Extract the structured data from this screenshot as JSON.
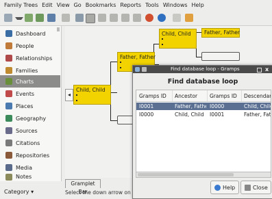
{
  "menubar": [
    "Family Trees",
    "Edit",
    "View",
    "Go",
    "Bookmarks",
    "Reports",
    "Tools",
    "Windows",
    "Help"
  ],
  "sidebar": {
    "items": [
      {
        "label": "Dashboard",
        "icon": "dashboard-icon",
        "color": "#3a6ea5"
      },
      {
        "label": "People",
        "icon": "people-icon",
        "color": "#c07a3a"
      },
      {
        "label": "Relationships",
        "icon": "relationships-icon",
        "color": "#b04a4a"
      },
      {
        "label": "Families",
        "icon": "families-icon",
        "color": "#c08a30"
      },
      {
        "label": "Charts",
        "icon": "charts-icon",
        "color": "#6a8f3a"
      },
      {
        "label": "Events",
        "icon": "events-icon",
        "color": "#c04a4a"
      },
      {
        "label": "Places",
        "icon": "places-icon",
        "color": "#4a7ab0"
      },
      {
        "label": "Geography",
        "icon": "geography-icon",
        "color": "#3a8a5a"
      },
      {
        "label": "Sources",
        "icon": "sources-icon",
        "color": "#6a6a8a"
      },
      {
        "label": "Citations",
        "icon": "citations-icon",
        "color": "#7a7a7a"
      },
      {
        "label": "Repositories",
        "icon": "repositories-icon",
        "color": "#8a5a3a"
      },
      {
        "label": "Media",
        "icon": "media-icon",
        "color": "#5a6a8a"
      },
      {
        "label": "Notes",
        "icon": "notes-icon",
        "color": "#8a8a5a"
      }
    ],
    "active_index": 4,
    "category_label": "Category ▾"
  },
  "chart": {
    "boxes": [
      {
        "name": "Child, Child"
      },
      {
        "name": "Father, Father"
      },
      {
        "name": "Child, Child"
      },
      {
        "name": "Father, Father"
      }
    ],
    "nav_arrow": "◂"
  },
  "gramplet_tab": "Gramplet Bar",
  "status": "Select the down arrow on the",
  "dialog": {
    "title": "Find database loop - Gramps",
    "heading": "Find database loop",
    "columns": [
      "Gramps ID",
      "Ancestor",
      "Gramps ID",
      "Descendar"
    ],
    "rows": [
      [
        "I0001",
        "Father, Father",
        "I0000",
        "Child, Child"
      ],
      [
        "I0000",
        "Child, Child",
        "I0001",
        "Father, Fath"
      ]
    ],
    "help_label": "Help",
    "close_label": "Close",
    "close_glyph": "x"
  }
}
